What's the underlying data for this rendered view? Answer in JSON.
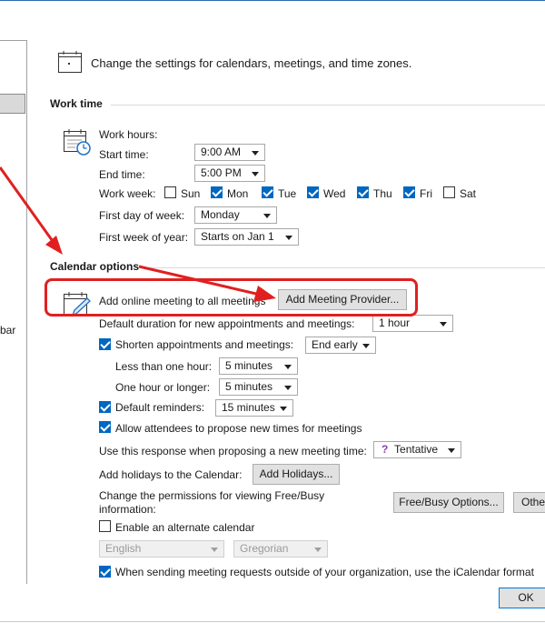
{
  "header": {
    "description": "Change the settings for calendars, meetings, and time zones."
  },
  "left_pane": {
    "partial_label": "bar"
  },
  "work_time": {
    "section_title": "Work time",
    "work_hours_label": "Work hours:",
    "start_time_label": "Start time:",
    "start_time_value": "9:00 AM",
    "end_time_label": "End time:",
    "end_time_value": "5:00 PM",
    "work_week_label": "Work week:",
    "days": [
      {
        "label": "Sun",
        "checked": false
      },
      {
        "label": "Mon",
        "checked": true
      },
      {
        "label": "Tue",
        "checked": true
      },
      {
        "label": "Wed",
        "checked": true
      },
      {
        "label": "Thu",
        "checked": true
      },
      {
        "label": "Fri",
        "checked": true
      },
      {
        "label": "Sat",
        "checked": false
      }
    ],
    "first_day_label": "First day of week:",
    "first_day_value": "Monday",
    "first_week_label": "First week of year:",
    "first_week_value": "Starts on Jan 1"
  },
  "calendar_options": {
    "section_title": "Calendar options",
    "online_meeting_label": "Add online meeting to all meetings",
    "add_provider_button": "Add Meeting Provider...",
    "default_duration_label": "Default duration for new appointments and meetings:",
    "default_duration_value": "1 hour",
    "shorten_label": "Shorten appointments and meetings:",
    "shorten_checked": true,
    "shorten_value": "End early",
    "less_than_hour_label": "Less than one hour:",
    "less_than_hour_value": "5 minutes",
    "hour_or_longer_label": "One hour or longer:",
    "hour_or_longer_value": "5 minutes",
    "default_reminders_label": "Default reminders:",
    "default_reminders_checked": true,
    "default_reminders_value": "15 minutes",
    "allow_propose_label": "Allow attendees to propose new times for meetings",
    "allow_propose_checked": true,
    "response_label": "Use this response when proposing a new meeting time:",
    "response_value": "Tentative",
    "holidays_label": "Add holidays to the Calendar:",
    "add_holidays_button": "Add Holidays...",
    "permissions_label_line1": "Change the permissions for viewing Free/Busy",
    "permissions_label_line2": "information:",
    "free_busy_button": "Free/Busy Options...",
    "other_button": "Othe",
    "alternate_calendar_label": "Enable an alternate calendar",
    "alternate_calendar_checked": false,
    "alt_language_value": "English",
    "alt_type_value": "Gregorian",
    "icalendar_label": "When sending meeting requests outside of your organization, use the iCalendar format",
    "icalendar_checked": true
  },
  "footer": {
    "ok_button": "OK"
  },
  "annotation": {
    "color": "#e02020"
  }
}
